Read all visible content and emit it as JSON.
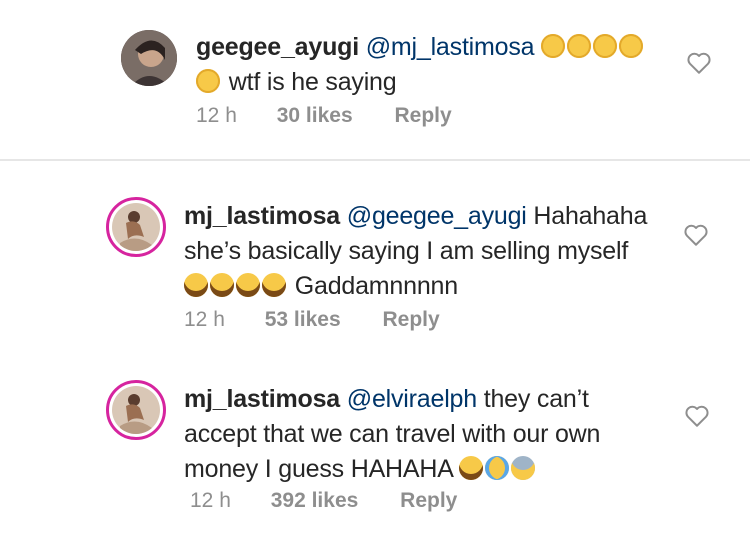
{
  "comments": [
    {
      "username": "geegee_ayugi",
      "mention": "@mj_lastimosa",
      "line1_emojis": [
        "flushed-emoji",
        "flushed-emoji",
        "flushed-emoji",
        "flushed-emoji"
      ],
      "line2_emoji": "flushed-emoji",
      "line2_text": "wtf is he saying",
      "time": "12 h",
      "likes": "30 likes",
      "reply": "Reply"
    },
    {
      "username": "mj_lastimosa",
      "mention": "@geegee_ayugi",
      "line1_rest": "Hahahaha",
      "line2_text": "she’s basically saying I am selling myself",
      "line3_emojis": [
        "laughing-emoji",
        "laughing-emoji",
        "laughing-emoji",
        "laughing-emoji"
      ],
      "line3_text": "Gaddamnnnnn",
      "time": "12 h",
      "likes": "53 likes",
      "reply": "Reply"
    },
    {
      "username": "mj_lastimosa",
      "mention": "@elviraelph",
      "line1_rest": "they can’t",
      "line2_text": "accept that we can travel with our own",
      "line3_text": "money I guess HAHAHA",
      "line3_emojis": [
        "laughing-emoji",
        "crying-emoji",
        "anxious-emoji"
      ],
      "time": "12 h",
      "likes": "392 likes",
      "reply": "Reply"
    }
  ],
  "colors": {
    "text": "#262626",
    "mention": "#003569",
    "meta": "#8e8e8e",
    "story_ring": "#d6249f",
    "emoji_yellow": "#f7c948"
  }
}
